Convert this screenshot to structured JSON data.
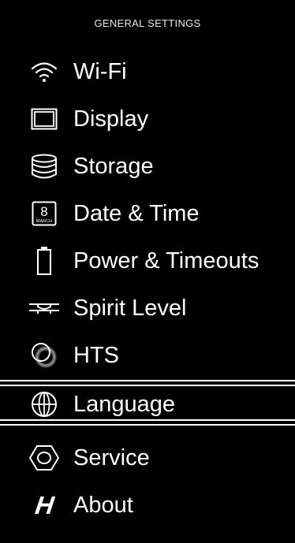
{
  "header": {
    "title": "GENERAL SETTINGS"
  },
  "menu": {
    "items": [
      {
        "label": "Wi-Fi",
        "icon": "wifi-icon"
      },
      {
        "label": "Display",
        "icon": "display-icon"
      },
      {
        "label": "Storage",
        "icon": "storage-icon"
      },
      {
        "label": "Date & Time",
        "icon": "calendar-icon",
        "icon_day": "8",
        "icon_month": "MARCH"
      },
      {
        "label": "Power & Timeouts",
        "icon": "battery-icon"
      },
      {
        "label": "Spirit Level",
        "icon": "spirit-level-icon"
      },
      {
        "label": "HTS",
        "icon": "hts-icon"
      },
      {
        "label": "Language",
        "icon": "globe-icon",
        "selected": true
      },
      {
        "label": "Service",
        "icon": "service-hex-icon"
      },
      {
        "label": "About",
        "icon": "hasselblad-logo-icon",
        "icon_text": "H"
      }
    ]
  }
}
